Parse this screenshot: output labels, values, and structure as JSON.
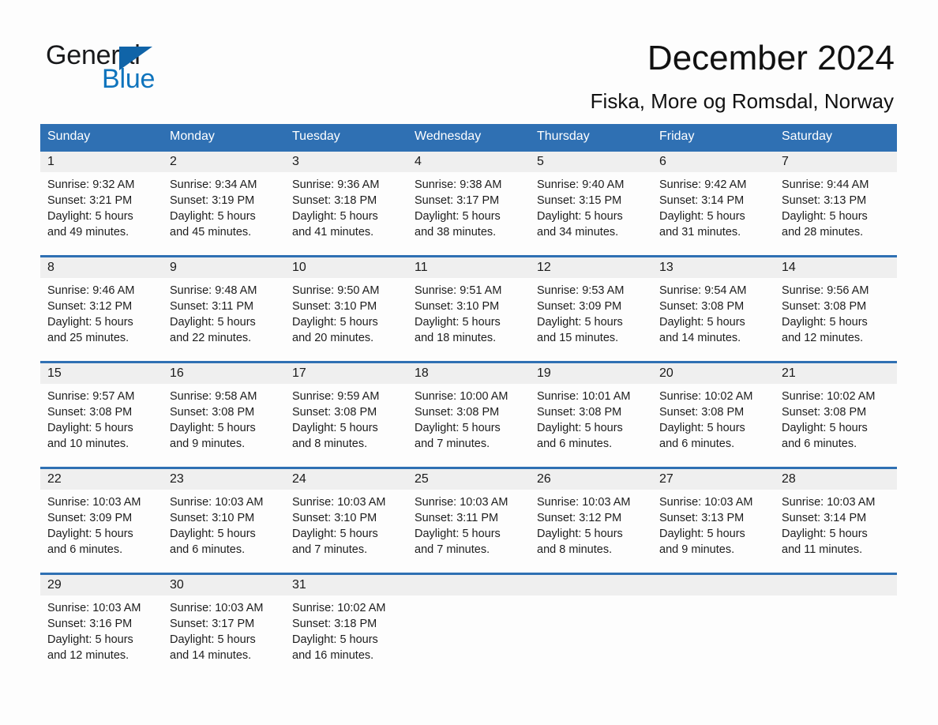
{
  "brand": {
    "name_part1": "General",
    "name_part2": "Blue",
    "accent_color": "#1064a8",
    "blue_text_color": "#0f74bd"
  },
  "header": {
    "title": "December 2024",
    "subtitle": "Fiska, More og Romsdal, Norway"
  },
  "calendar": {
    "header_bg_color": "#2f70b3",
    "daynum_bg_color": "#efefef",
    "weekday_headers": [
      "Sunday",
      "Monday",
      "Tuesday",
      "Wednesday",
      "Thursday",
      "Friday",
      "Saturday"
    ],
    "weeks": [
      {
        "days": [
          {
            "num": "1",
            "info": "Sunrise: 9:32 AM\nSunset: 3:21 PM\nDaylight: 5 hours\nand 49 minutes."
          },
          {
            "num": "2",
            "info": "Sunrise: 9:34 AM\nSunset: 3:19 PM\nDaylight: 5 hours\nand 45 minutes."
          },
          {
            "num": "3",
            "info": "Sunrise: 9:36 AM\nSunset: 3:18 PM\nDaylight: 5 hours\nand 41 minutes."
          },
          {
            "num": "4",
            "info": "Sunrise: 9:38 AM\nSunset: 3:17 PM\nDaylight: 5 hours\nand 38 minutes."
          },
          {
            "num": "5",
            "info": "Sunrise: 9:40 AM\nSunset: 3:15 PM\nDaylight: 5 hours\nand 34 minutes."
          },
          {
            "num": "6",
            "info": "Sunrise: 9:42 AM\nSunset: 3:14 PM\nDaylight: 5 hours\nand 31 minutes."
          },
          {
            "num": "7",
            "info": "Sunrise: 9:44 AM\nSunset: 3:13 PM\nDaylight: 5 hours\nand 28 minutes."
          }
        ]
      },
      {
        "days": [
          {
            "num": "8",
            "info": "Sunrise: 9:46 AM\nSunset: 3:12 PM\nDaylight: 5 hours\nand 25 minutes."
          },
          {
            "num": "9",
            "info": "Sunrise: 9:48 AM\nSunset: 3:11 PM\nDaylight: 5 hours\nand 22 minutes."
          },
          {
            "num": "10",
            "info": "Sunrise: 9:50 AM\nSunset: 3:10 PM\nDaylight: 5 hours\nand 20 minutes."
          },
          {
            "num": "11",
            "info": "Sunrise: 9:51 AM\nSunset: 3:10 PM\nDaylight: 5 hours\nand 18 minutes."
          },
          {
            "num": "12",
            "info": "Sunrise: 9:53 AM\nSunset: 3:09 PM\nDaylight: 5 hours\nand 15 minutes."
          },
          {
            "num": "13",
            "info": "Sunrise: 9:54 AM\nSunset: 3:08 PM\nDaylight: 5 hours\nand 14 minutes."
          },
          {
            "num": "14",
            "info": "Sunrise: 9:56 AM\nSunset: 3:08 PM\nDaylight: 5 hours\nand 12 minutes."
          }
        ]
      },
      {
        "days": [
          {
            "num": "15",
            "info": "Sunrise: 9:57 AM\nSunset: 3:08 PM\nDaylight: 5 hours\nand 10 minutes."
          },
          {
            "num": "16",
            "info": "Sunrise: 9:58 AM\nSunset: 3:08 PM\nDaylight: 5 hours\nand 9 minutes."
          },
          {
            "num": "17",
            "info": "Sunrise: 9:59 AM\nSunset: 3:08 PM\nDaylight: 5 hours\nand 8 minutes."
          },
          {
            "num": "18",
            "info": "Sunrise: 10:00 AM\nSunset: 3:08 PM\nDaylight: 5 hours\nand 7 minutes."
          },
          {
            "num": "19",
            "info": "Sunrise: 10:01 AM\nSunset: 3:08 PM\nDaylight: 5 hours\nand 6 minutes."
          },
          {
            "num": "20",
            "info": "Sunrise: 10:02 AM\nSunset: 3:08 PM\nDaylight: 5 hours\nand 6 minutes."
          },
          {
            "num": "21",
            "info": "Sunrise: 10:02 AM\nSunset: 3:08 PM\nDaylight: 5 hours\nand 6 minutes."
          }
        ]
      },
      {
        "days": [
          {
            "num": "22",
            "info": "Sunrise: 10:03 AM\nSunset: 3:09 PM\nDaylight: 5 hours\nand 6 minutes."
          },
          {
            "num": "23",
            "info": "Sunrise: 10:03 AM\nSunset: 3:10 PM\nDaylight: 5 hours\nand 6 minutes."
          },
          {
            "num": "24",
            "info": "Sunrise: 10:03 AM\nSunset: 3:10 PM\nDaylight: 5 hours\nand 7 minutes."
          },
          {
            "num": "25",
            "info": "Sunrise: 10:03 AM\nSunset: 3:11 PM\nDaylight: 5 hours\nand 7 minutes."
          },
          {
            "num": "26",
            "info": "Sunrise: 10:03 AM\nSunset: 3:12 PM\nDaylight: 5 hours\nand 8 minutes."
          },
          {
            "num": "27",
            "info": "Sunrise: 10:03 AM\nSunset: 3:13 PM\nDaylight: 5 hours\nand 9 minutes."
          },
          {
            "num": "28",
            "info": "Sunrise: 10:03 AM\nSunset: 3:14 PM\nDaylight: 5 hours\nand 11 minutes."
          }
        ]
      },
      {
        "days": [
          {
            "num": "29",
            "info": "Sunrise: 10:03 AM\nSunset: 3:16 PM\nDaylight: 5 hours\nand 12 minutes."
          },
          {
            "num": "30",
            "info": "Sunrise: 10:03 AM\nSunset: 3:17 PM\nDaylight: 5 hours\nand 14 minutes."
          },
          {
            "num": "31",
            "info": "Sunrise: 10:02 AM\nSunset: 3:18 PM\nDaylight: 5 hours\nand 16 minutes."
          },
          {
            "num": "",
            "info": ""
          },
          {
            "num": "",
            "info": ""
          },
          {
            "num": "",
            "info": ""
          },
          {
            "num": "",
            "info": ""
          }
        ]
      }
    ]
  }
}
